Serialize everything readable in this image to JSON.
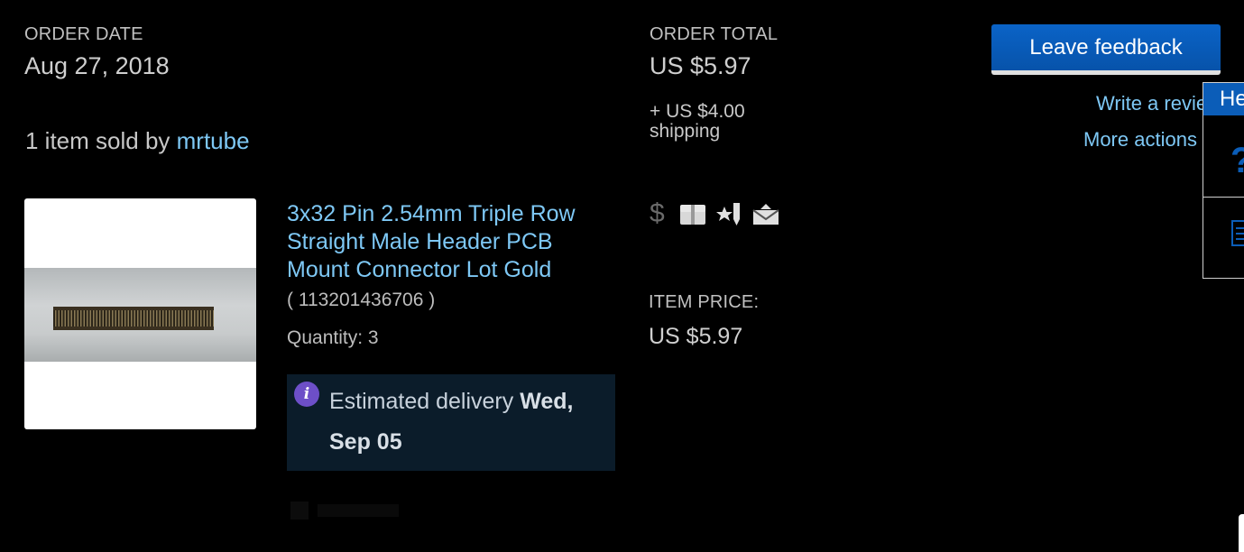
{
  "order": {
    "date_label": "ORDER DATE",
    "date_value": "Aug 27, 2018",
    "total_label": "ORDER TOTAL",
    "total_value": "US $5.97",
    "shipping_amount": "+ US $4.00",
    "shipping_label": "shipping"
  },
  "seller": {
    "prefix": "1 item sold by ",
    "name": "mrtube"
  },
  "actions": {
    "leave_feedback": "Leave feedback",
    "write_review": "Write a revie",
    "more_actions": "More actions"
  },
  "item": {
    "title": "3x32 Pin 2.54mm Triple Row Straight Male Header PCB Mount Connector Lot Gold",
    "number": "( 113201436706 )",
    "quantity": "Quantity: 3",
    "price_label": "ITEM PRICE:",
    "price_value": "US $5.97"
  },
  "delivery": {
    "prefix": "Estimated delivery ",
    "date": "Wed, Sep 05"
  },
  "help_panel": {
    "title": "He"
  },
  "status_icons": [
    "dollar-icon",
    "package-icon",
    "star-feedback-icon",
    "envelope-icon"
  ],
  "colors": {
    "background": "#000000",
    "link": "#7ec8f5",
    "button": "#0a63c7",
    "info": "#6d4fc8",
    "delivery_bg": "#0b1c2a"
  }
}
